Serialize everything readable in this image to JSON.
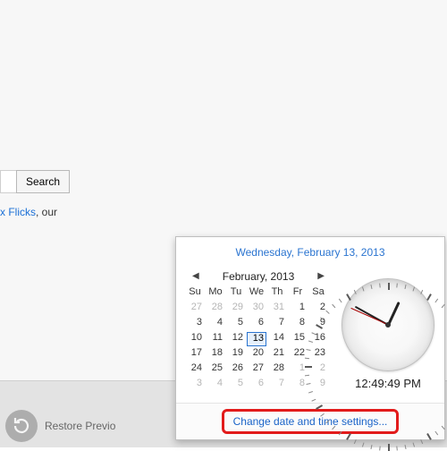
{
  "search": {
    "button_label": "Search",
    "placeholder": ""
  },
  "flicks": {
    "link_text": "x Flicks",
    "suffix": ", our"
  },
  "restore": {
    "label": "Restore Previo"
  },
  "datetime_popup": {
    "full_date": "Wednesday, February 13, 2013",
    "month_label": "February, 2013",
    "dow": [
      "Su",
      "Mo",
      "Tu",
      "We",
      "Th",
      "Fr",
      "Sa"
    ],
    "grid_start_weekday": 0,
    "prev_days": [
      27,
      28,
      29,
      30,
      31
    ],
    "days": [
      1,
      2,
      3,
      4,
      5,
      6,
      7,
      8,
      9,
      10,
      11,
      12,
      13,
      14,
      15,
      16,
      17,
      18,
      19,
      20,
      21,
      22,
      23,
      24,
      25,
      26,
      27,
      28
    ],
    "next_days": [
      1,
      2,
      3,
      4,
      5,
      6,
      7,
      8,
      9
    ],
    "today": 13,
    "digital_time": "12:49:49 PM",
    "hour_hand_deg": 24.9,
    "minute_hand_deg": 298.9,
    "second_hand_deg": 294.0,
    "change_link": "Change date and time settings..."
  }
}
